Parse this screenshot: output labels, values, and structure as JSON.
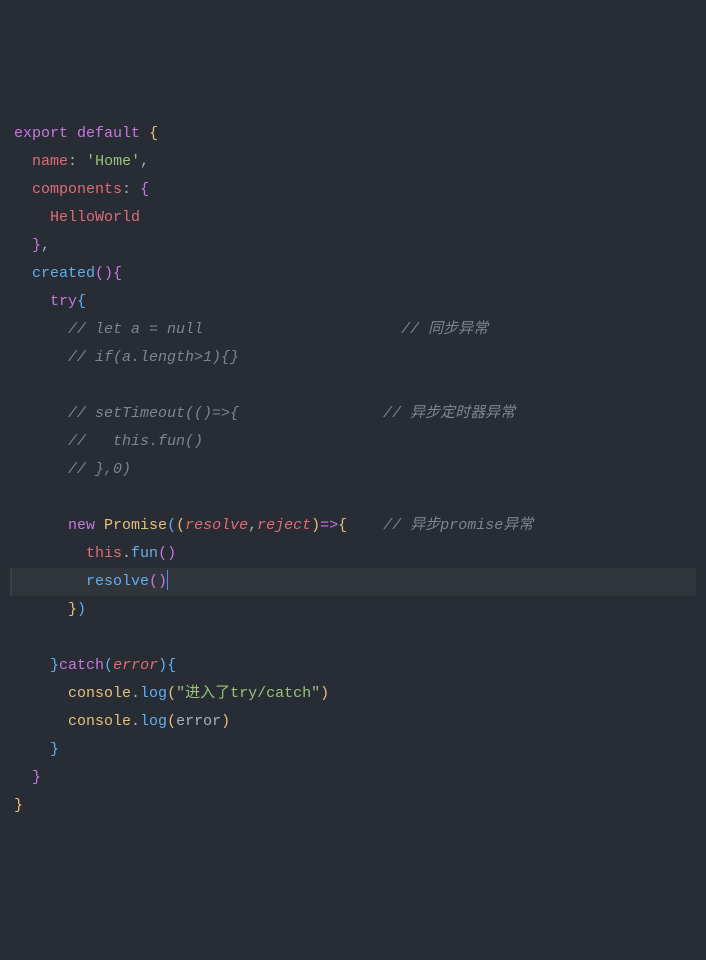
{
  "line1": {
    "kw1": "export",
    "kw2": "default",
    "brace": "{"
  },
  "line2": {
    "prop": "name",
    "colon": ":",
    "str": "'Home'",
    "comma": ","
  },
  "line3": {
    "prop": "components",
    "colon": ":",
    "brace": "{"
  },
  "line4": {
    "ident": "HelloWorld"
  },
  "line5": {
    "brace": "}",
    "comma": ","
  },
  "line6": {
    "fn": "created",
    "parens": "()",
    "brace": "{"
  },
  "line7": {
    "kw": "try",
    "brace": "{"
  },
  "line8": {
    "comment": "// let a = null",
    "comment2": "// 同步异常"
  },
  "line9": {
    "comment": "// if(a.length>1){}"
  },
  "line10": {
    "comment": "// setTimeout(()=>{",
    "comment2": "// 异步定时器异常"
  },
  "line11": {
    "comment": "//   this.fun()"
  },
  "line12": {
    "comment": "// },0)"
  },
  "line13": {
    "kw": "new",
    "class": "Promise",
    "lp": "((",
    "p1": "resolve",
    "comma": ",",
    "p2": "reject",
    "rp": ")",
    "arrow": "=>",
    "brace": "{",
    "comment": "// 异步promise异常"
  },
  "line14": {
    "kw": "this",
    "dot": ".",
    "fn": "fun",
    "parens": "()"
  },
  "line15": {
    "fn": "resolve",
    "parens": "()"
  },
  "line16": {
    "brace": "}",
    "rp": ")"
  },
  "line17": {
    "brace1": "}",
    "kw": "catch",
    "lp": "(",
    "param": "error",
    "rp": ")",
    "brace2": "{"
  },
  "line18": {
    "obj": "console",
    "dot": ".",
    "fn": "log",
    "lp": "(",
    "str": "\"进入了try/catch\"",
    "rp": ")"
  },
  "line19": {
    "obj": "console",
    "dot": ".",
    "fn": "log",
    "lp": "(",
    "param": "error",
    "rp": ")"
  },
  "line20": {
    "brace": "}"
  },
  "line21": {
    "brace": "}"
  },
  "line22": {
    "brace": "}"
  }
}
